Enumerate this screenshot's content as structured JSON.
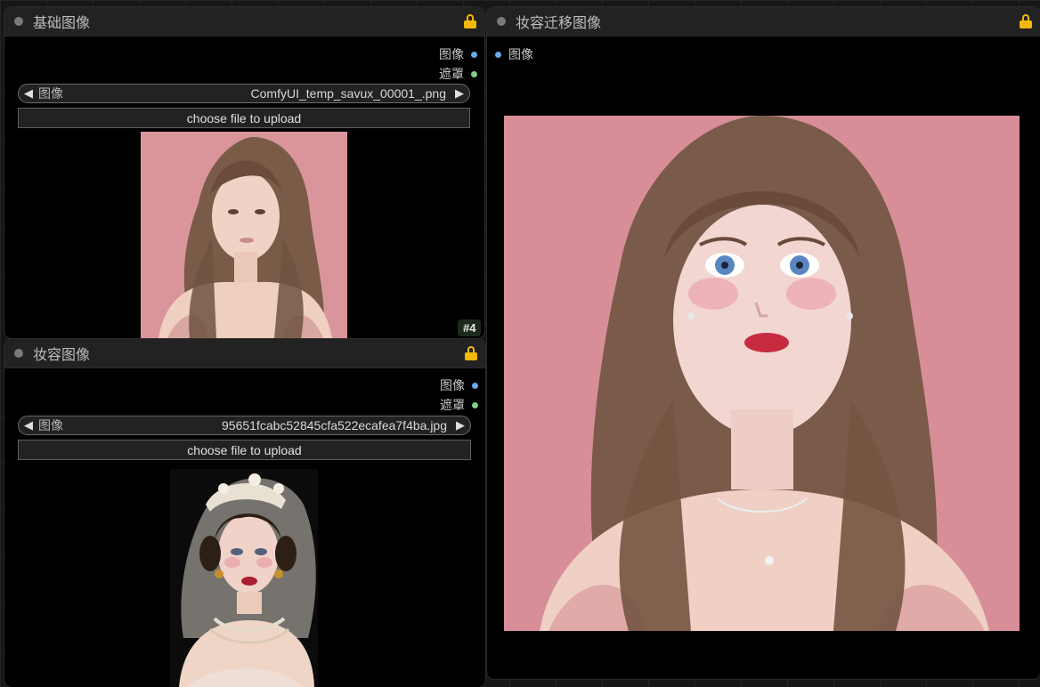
{
  "colors": {
    "image_port": "#6aa9e8",
    "mask_port": "#7dcf8a",
    "lock": "#f2b90c",
    "background_pink": "#d9909a"
  },
  "nodes": {
    "base_image": {
      "title": "基础图像",
      "outputs": [
        "图像",
        "遮罩"
      ],
      "widget_label": "图像",
      "widget_value": "ComfyUI_temp_savux_00001_.png",
      "upload_label": "choose file to upload",
      "badge": "#4"
    },
    "makeup_image": {
      "title": "妆容图像",
      "outputs": [
        "图像",
        "遮罩"
      ],
      "widget_label": "图像",
      "widget_value": "95651fcabc52845cfa522ecafea7f4ba.jpg",
      "upload_label": "choose file to upload"
    },
    "transfer_image": {
      "title": "妆容迁移图像",
      "input": "图像"
    }
  },
  "icons": {
    "arrow_left": "◀",
    "arrow_right": "▶"
  }
}
